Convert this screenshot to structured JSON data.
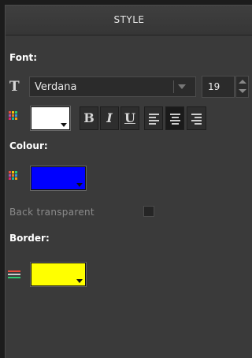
{
  "header": {
    "title": "STYLE"
  },
  "font_section": {
    "label": "Font:",
    "font_name": "Verdana",
    "font_size": "19",
    "text_color": "#ffffff",
    "buttons": {
      "bold": "B",
      "italic": "I",
      "underline": "U"
    }
  },
  "colour_section": {
    "label": "Colour:",
    "color": "#0000ff"
  },
  "back_transparent": {
    "label": "Back transparent",
    "checked": false
  },
  "border_section": {
    "label": "Border:",
    "color": "#ffff00"
  },
  "icons": [
    "font-T-icon",
    "color-palette-icon",
    "align-left-icon",
    "align-center-icon",
    "align-right-icon",
    "border-lines-icon",
    "dropdown-arrow-icon",
    "spin-up-icon",
    "spin-down-icon"
  ]
}
